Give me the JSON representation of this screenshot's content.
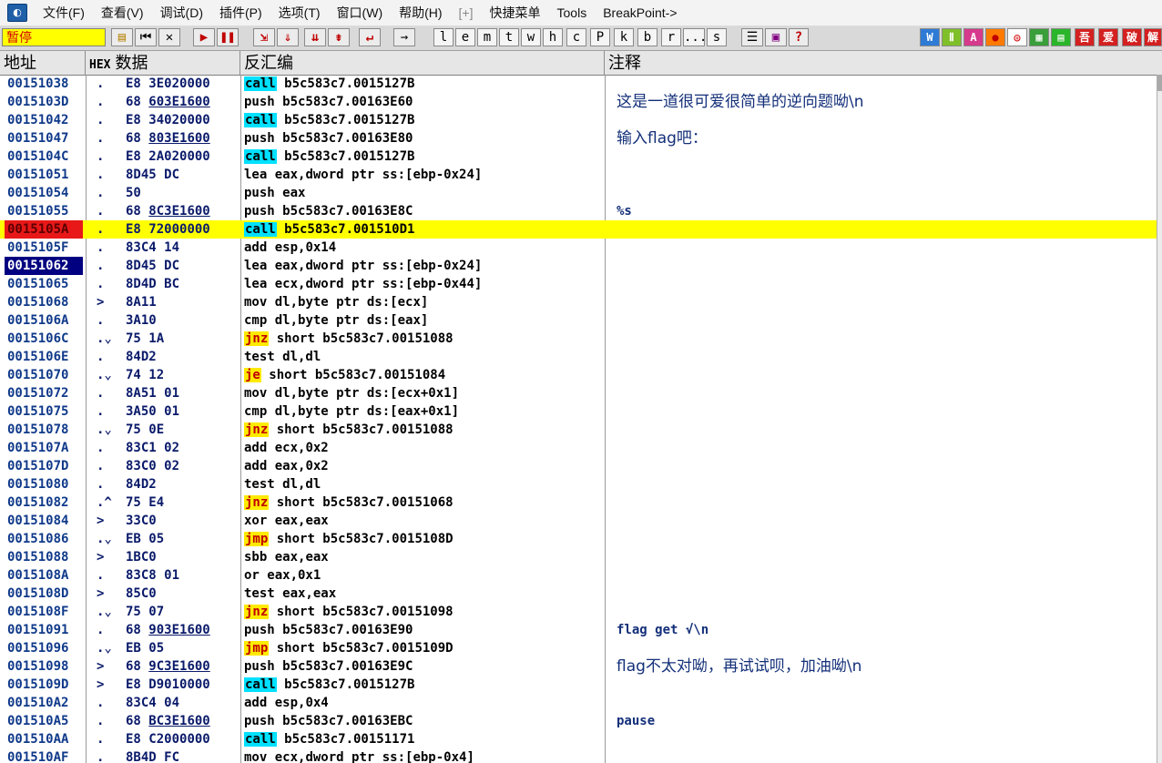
{
  "menu": {
    "items": [
      "文件(F)",
      "查看(V)",
      "调试(D)",
      "插件(P)",
      "选项(T)",
      "窗口(W)",
      "帮助(H)",
      "[+]",
      "快捷菜单",
      "Tools",
      "BreakPoint->"
    ]
  },
  "toolbar": {
    "status": "暂停",
    "letters": [
      "l",
      "e",
      "m",
      "t",
      "w",
      "h",
      "c",
      "P",
      "k",
      "b",
      "r",
      "...",
      "s"
    ],
    "right_icons": [
      "W",
      "Ⅱ",
      "A",
      "●",
      "◎",
      "▦",
      "▤",
      "吾",
      "爱",
      "破",
      "解"
    ]
  },
  "columns": {
    "addr": "地址",
    "hex_prefix": "HEX",
    "hex": "数据",
    "disasm": "反汇编",
    "comment": "注释"
  },
  "rows": [
    {
      "addr": "00151038",
      "mark": ".",
      "hex1": "E8",
      "hex2": "3E020000",
      "mn": "call",
      "ops": " b5c583c7.0015127B",
      "comment": ""
    },
    {
      "addr": "0015103D",
      "mark": ".",
      "hex1": "68",
      "hex2": "603E1600",
      "mn": "push",
      "ops": " b5c583c7.00163E60",
      "comment": "这是一道很可爱很简单的逆向题呦\\n"
    },
    {
      "addr": "00151042",
      "mark": ".",
      "hex1": "E8",
      "hex2": "34020000",
      "mn": "call",
      "ops": " b5c583c7.0015127B",
      "comment": ""
    },
    {
      "addr": "00151047",
      "mark": ".",
      "hex1": "68",
      "hex2": "803E1600",
      "mn": "push",
      "ops": " b5c583c7.00163E80",
      "comment": "输入flag吧："
    },
    {
      "addr": "0015104C",
      "mark": ".",
      "hex1": "E8",
      "hex2": "2A020000",
      "mn": "call",
      "ops": " b5c583c7.0015127B",
      "comment": ""
    },
    {
      "addr": "00151051",
      "mark": ".",
      "hex1": "8D45",
      "hex2": "DC",
      "mn": "lea",
      "ops": " eax,dword ptr ss:[ebp-0x24]",
      "comment": ""
    },
    {
      "addr": "00151054",
      "mark": ".",
      "hex1": "50",
      "hex2": "",
      "mn": "push",
      "ops": " eax",
      "comment": ""
    },
    {
      "addr": "00151055",
      "mark": ".",
      "hex1": "68",
      "hex2": "8C3E1600",
      "mn": "push",
      "ops": " b5c583c7.00163E8C",
      "comment": "%s"
    },
    {
      "addr": "0015105A",
      "mark": ".",
      "hex1": "E8",
      "hex2": "72000000",
      "mn": "call",
      "ops": " b5c583c7.001510D1",
      "comment": ""
    },
    {
      "addr": "0015105F",
      "mark": ".",
      "hex1": "83C4",
      "hex2": "14",
      "mn": "add",
      "ops": " esp,0x14",
      "comment": ""
    },
    {
      "addr": "00151062",
      "mark": ".",
      "hex1": "8D45",
      "hex2": "DC",
      "mn": "lea",
      "ops": " eax,dword ptr ss:[ebp-0x24]",
      "comment": ""
    },
    {
      "addr": "00151065",
      "mark": ".",
      "hex1": "8D4D",
      "hex2": "BC",
      "mn": "lea",
      "ops": " ecx,dword ptr ss:[ebp-0x44]",
      "comment": ""
    },
    {
      "addr": "00151068",
      "mark": ">",
      "hex1": "8A11",
      "hex2": "",
      "mn": "mov",
      "ops": " dl,byte ptr ds:[ecx]",
      "comment": ""
    },
    {
      "addr": "0015106A",
      "mark": ".",
      "hex1": "3A10",
      "hex2": "",
      "mn": "cmp",
      "ops": " dl,byte ptr ds:[eax]",
      "comment": ""
    },
    {
      "addr": "0015106C",
      "mark": ".⌄",
      "hex1": "75",
      "hex2": "1A",
      "mn": "jnz",
      "ops": " short b5c583c7.00151088",
      "comment": ""
    },
    {
      "addr": "0015106E",
      "mark": ".",
      "hex1": "84D2",
      "hex2": "",
      "mn": "test",
      "ops": " dl,dl",
      "comment": ""
    },
    {
      "addr": "00151070",
      "mark": ".⌄",
      "hex1": "74",
      "hex2": "12",
      "mn": "je",
      "ops": " short b5c583c7.00151084",
      "comment": ""
    },
    {
      "addr": "00151072",
      "mark": ".",
      "hex1": "8A51",
      "hex2": "01",
      "mn": "mov",
      "ops": " dl,byte ptr ds:[ecx+0x1]",
      "comment": ""
    },
    {
      "addr": "00151075",
      "mark": ".",
      "hex1": "3A50",
      "hex2": "01",
      "mn": "cmp",
      "ops": " dl,byte ptr ds:[eax+0x1]",
      "comment": ""
    },
    {
      "addr": "00151078",
      "mark": ".⌄",
      "hex1": "75",
      "hex2": "0E",
      "mn": "jnz",
      "ops": " short b5c583c7.00151088",
      "comment": ""
    },
    {
      "addr": "0015107A",
      "mark": ".",
      "hex1": "83C1",
      "hex2": "02",
      "mn": "add",
      "ops": " ecx,0x2",
      "comment": ""
    },
    {
      "addr": "0015107D",
      "mark": ".",
      "hex1": "83C0",
      "hex2": "02",
      "mn": "add",
      "ops": " eax,0x2",
      "comment": ""
    },
    {
      "addr": "00151080",
      "mark": ".",
      "hex1": "84D2",
      "hex2": "",
      "mn": "test",
      "ops": " dl,dl",
      "comment": ""
    },
    {
      "addr": "00151082",
      "mark": ".^",
      "hex1": "75",
      "hex2": "E4",
      "mn": "jnz",
      "ops": " short b5c583c7.00151068",
      "comment": ""
    },
    {
      "addr": "00151084",
      "mark": ">",
      "hex1": "33C0",
      "hex2": "",
      "mn": "xor",
      "ops": " eax,eax",
      "comment": ""
    },
    {
      "addr": "00151086",
      "mark": ".⌄",
      "hex1": "EB",
      "hex2": "05",
      "mn": "jmp",
      "ops": " short b5c583c7.0015108D",
      "comment": ""
    },
    {
      "addr": "00151088",
      "mark": ">",
      "hex1": "1BC0",
      "hex2": "",
      "mn": "sbb",
      "ops": " eax,eax",
      "comment": ""
    },
    {
      "addr": "0015108A",
      "mark": ".",
      "hex1": "83C8",
      "hex2": "01",
      "mn": "or",
      "ops": " eax,0x1",
      "comment": ""
    },
    {
      "addr": "0015108D",
      "mark": ">",
      "hex1": "85C0",
      "hex2": "",
      "mn": "test",
      "ops": " eax,eax",
      "comment": ""
    },
    {
      "addr": "0015108F",
      "mark": ".⌄",
      "hex1": "75",
      "hex2": "07",
      "mn": "jnz",
      "ops": " short b5c583c7.00151098",
      "comment": ""
    },
    {
      "addr": "00151091",
      "mark": ".",
      "hex1": "68",
      "hex2": "903E1600",
      "mn": "push",
      "ops": " b5c583c7.00163E90",
      "comment": "flag get √\\n"
    },
    {
      "addr": "00151096",
      "mark": ".⌄",
      "hex1": "EB",
      "hex2": "05",
      "mn": "jmp",
      "ops": " short b5c583c7.0015109D",
      "comment": ""
    },
    {
      "addr": "00151098",
      "mark": ">",
      "hex1": "68",
      "hex2": "9C3E1600",
      "mn": "push",
      "ops": " b5c583c7.00163E9C",
      "comment": "flag不太对呦，再试试呗，加油呦\\n"
    },
    {
      "addr": "0015109D",
      "mark": ">",
      "hex1": "E8",
      "hex2": "D9010000",
      "mn": "call",
      "ops": " b5c583c7.0015127B",
      "comment": ""
    },
    {
      "addr": "001510A2",
      "mark": ".",
      "hex1": "83C4",
      "hex2": "04",
      "mn": "add",
      "ops": " esp,0x4",
      "comment": ""
    },
    {
      "addr": "001510A5",
      "mark": ".",
      "hex1": "68",
      "hex2": "BC3E1600",
      "mn": "push",
      "ops": " b5c583c7.00163EBC",
      "comment": "pause"
    },
    {
      "addr": "001510AA",
      "mark": ".",
      "hex1": "E8",
      "hex2": "C2000000",
      "mn": "call",
      "ops": " b5c583c7.00151171",
      "comment": ""
    },
    {
      "addr": "001510AF",
      "mark": ".",
      "hex1": "8B4D",
      "hex2": "FC",
      "mn": "mov",
      "ops": " ecx,dword ptr ss:[ebp-0x4]",
      "comment": ""
    }
  ],
  "highlighted_row": "0015105A",
  "selected_row": "00151062",
  "colors": {
    "highlight": "#ffff00",
    "breakpoint": "#e81818",
    "selection": "#000080",
    "call_bg": "#00e0ff",
    "jump_bg": "#ffea00"
  }
}
